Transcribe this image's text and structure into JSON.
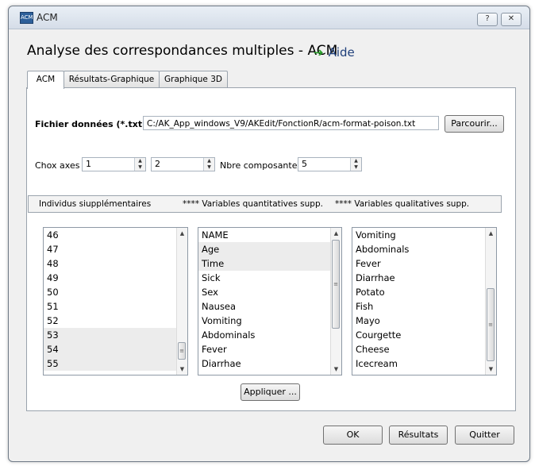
{
  "window": {
    "title": "ACM",
    "help_btn": "?",
    "close_btn": "✕",
    "icon_text": "ACM"
  },
  "header": {
    "title": "Analyse  des correspondances multiples - ACM",
    "aide": "Aide"
  },
  "tabs": [
    {
      "label": "ACM"
    },
    {
      "label": "Résultats-Graphique"
    },
    {
      "label": "Graphique 3D"
    }
  ],
  "file": {
    "label": "Fichier données (*.txt )",
    "path": "C:/AK_App_windows_V9/AKEdit/FonctionR/acm-format-poison.txt",
    "browse": "Parcourir..."
  },
  "axes": {
    "label": "Chox axes",
    "axis1": "1",
    "axis2": "2",
    "components_label": "Nbre composantes",
    "components": "5"
  },
  "strip": {
    "individus": "Individus siupplémentaires",
    "quant": "****  Variables quantitatives supp.",
    "qual": "****  Variables qualitatives supp."
  },
  "lists": {
    "individus": [
      "46",
      "47",
      "48",
      "49",
      "50",
      "51",
      "52",
      "53",
      "54",
      "55"
    ],
    "quant": [
      "NAME",
      "Age",
      "Time",
      "Sick",
      "Sex",
      "Nausea",
      "Vomiting",
      "Abdominals",
      "Fever",
      "Diarrhae"
    ],
    "qual": [
      "Vomiting",
      "Abdominals",
      "Fever",
      "Diarrhae",
      "Potato",
      "Fish",
      "Mayo",
      "Courgette",
      "Cheese",
      "Icecream"
    ]
  },
  "buttons": {
    "apply": "Appliquer ...",
    "ok": "OK",
    "results": "Résultats",
    "quit": "Quitter"
  }
}
